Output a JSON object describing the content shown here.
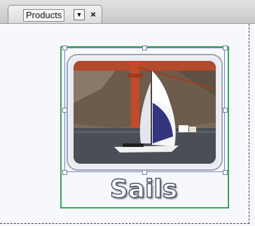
{
  "tab": {
    "label": "Products",
    "menu_glyph": "▼",
    "close_glyph": "×"
  },
  "canvas": {
    "caption": "Sails",
    "image_subject": "sailboat with blue and white spinnaker near a red bridge tower"
  },
  "colors": {
    "selection_green": "#3aa654",
    "selection_blue": "#6e86c8",
    "caption_outline": "#4e5566"
  }
}
